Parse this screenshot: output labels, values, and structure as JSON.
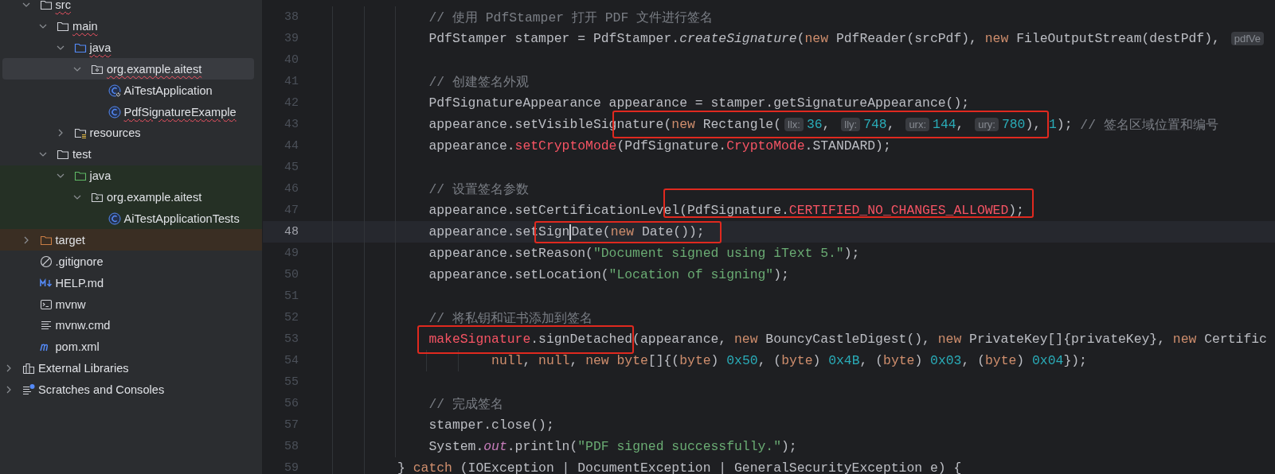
{
  "sidebar": {
    "project_files": [
      {
        "name": "src",
        "kind": "folder",
        "expanded": true,
        "error": true,
        "selected": false,
        "children": [
          {
            "name": "main",
            "kind": "folder",
            "expanded": true,
            "error": true,
            "selected": false,
            "children": [
              {
                "name": "java",
                "kind": "source-folder",
                "expanded": true,
                "error": true,
                "selected": false,
                "children": [
                  {
                    "name": "org.example.aitest",
                    "kind": "package",
                    "expanded": true,
                    "error": true,
                    "selected": true,
                    "children": [
                      {
                        "name": "AiTestApplication",
                        "kind": "main-class",
                        "error": false,
                        "selected": false
                      },
                      {
                        "name": "PdfSignatureExample",
                        "kind": "class",
                        "error": true,
                        "selected": false
                      }
                    ]
                  }
                ]
              },
              {
                "name": "resources",
                "kind": "resources-folder",
                "expanded": false,
                "error": false,
                "selected": false
              }
            ]
          },
          {
            "name": "test",
            "kind": "folder",
            "expanded": true,
            "error": false,
            "selected": false,
            "children": [
              {
                "name": "java",
                "kind": "test-folder",
                "expanded": true,
                "error": false,
                "selected": false,
                "color": "#253025",
                "children": [
                  {
                    "name": "org.example.aitest",
                    "kind": "package",
                    "expanded": true,
                    "error": false,
                    "selected": false,
                    "color": "#253025",
                    "children": [
                      {
                        "name": "AiTestApplicationTests",
                        "kind": "class",
                        "error": false,
                        "selected": false,
                        "color": "#253025"
                      }
                    ]
                  }
                ]
              }
            ]
          }
        ]
      },
      {
        "name": "target",
        "kind": "excluded-folder",
        "expanded": false,
        "error": false,
        "selected": false,
        "color": "#3a2e23"
      },
      {
        "name": ".gitignore",
        "kind": "gitignore",
        "error": false,
        "selected": false
      },
      {
        "name": "HELP.md",
        "kind": "markdown",
        "error": false,
        "selected": false
      },
      {
        "name": "mvnw",
        "kind": "script",
        "error": false,
        "selected": false
      },
      {
        "name": "mvnw.cmd",
        "kind": "text",
        "error": false,
        "selected": false
      },
      {
        "name": "pom.xml",
        "kind": "maven",
        "error": false,
        "selected": false
      }
    ],
    "roots": [
      {
        "name": "External Libraries",
        "kind": "libraries",
        "expanded": false,
        "error": false,
        "selected": false
      },
      {
        "name": "Scratches and Consoles",
        "kind": "scratches",
        "expanded": false,
        "error": false,
        "selected": false
      }
    ]
  },
  "editor": {
    "lines": [
      {
        "number": "38",
        "current": false,
        "kind": "statement",
        "tokens": [
          {
            "kind": "comment",
            "text": "// 使用 PdfStamper 打开 PDF 文件进行签名"
          }
        ]
      },
      {
        "number": "39",
        "current": false,
        "kind": "statement",
        "tokens": [
          {
            "kind": "plain",
            "text": "PdfStamper stamper = PdfStamper."
          },
          {
            "kind": "italic",
            "text": "createSignature"
          },
          {
            "kind": "plain",
            "text": "("
          },
          {
            "kind": "keyword",
            "text": "new"
          },
          {
            "kind": "plain",
            "text": " PdfReader(srcPdf), "
          },
          {
            "kind": "keyword",
            "text": "new"
          },
          {
            "kind": "plain",
            "text": " FileOutputStream(destPdf), "
          },
          {
            "kind": "hint",
            "text": "pdfVe"
          }
        ]
      },
      {
        "number": "40",
        "current": false,
        "kind": "statement"
      },
      {
        "number": "41",
        "current": false,
        "kind": "statement",
        "tokens": [
          {
            "kind": "comment",
            "text": "// 创建签名外观"
          }
        ]
      },
      {
        "number": "42",
        "current": false,
        "kind": "statement",
        "tokens": [
          {
            "kind": "plain",
            "text": "PdfSignatureAppearance appearance = stamper.getSignatureAppearance();"
          }
        ]
      },
      {
        "number": "43",
        "current": false,
        "kind": "statement",
        "tokens": [
          {
            "kind": "plain",
            "text": "appearance.setVisibleSignature("
          },
          {
            "kind": "keyword",
            "text": "new"
          },
          {
            "kind": "plain",
            "text": " Rectangle("
          },
          {
            "kind": "hint",
            "text": "llx:"
          },
          {
            "kind": "number",
            "text": "36"
          },
          {
            "kind": "plain",
            "text": ", "
          },
          {
            "kind": "hint",
            "text": "lly:"
          },
          {
            "kind": "number",
            "text": "748"
          },
          {
            "kind": "plain",
            "text": ", "
          },
          {
            "kind": "hint",
            "text": "urx:"
          },
          {
            "kind": "number",
            "text": "144"
          },
          {
            "kind": "plain",
            "text": ", "
          },
          {
            "kind": "hint",
            "text": "ury:"
          },
          {
            "kind": "number",
            "text": "780"
          },
          {
            "kind": "plain",
            "text": "), "
          },
          {
            "kind": "number",
            "text": "1"
          },
          {
            "kind": "plain",
            "text": "); "
          },
          {
            "kind": "comment",
            "text": "// 签名区域位置和编号"
          }
        ]
      },
      {
        "number": "44",
        "current": false,
        "kind": "statement",
        "tokens": [
          {
            "kind": "plain",
            "text": "appearance."
          },
          {
            "kind": "error",
            "text": "setCryptoMode"
          },
          {
            "kind": "plain",
            "text": "(PdfSignature."
          },
          {
            "kind": "error",
            "text": "CryptoMode"
          },
          {
            "kind": "plain",
            "text": ".STANDARD);"
          }
        ]
      },
      {
        "number": "45",
        "current": false,
        "kind": "statement"
      },
      {
        "number": "46",
        "current": false,
        "kind": "statement",
        "tokens": [
          {
            "kind": "comment",
            "text": "// 设置签名参数"
          }
        ]
      },
      {
        "number": "47",
        "current": false,
        "kind": "statement",
        "tokens": [
          {
            "kind": "plain",
            "text": "appearance.setCertificationLevel(PdfSignature."
          },
          {
            "kind": "error",
            "text": "CERTIFIED_NO_CHANGES_ALLOWED"
          },
          {
            "kind": "plain",
            "text": ");"
          }
        ]
      },
      {
        "number": "48",
        "current": true,
        "kind": "statement",
        "tokens": [
          {
            "kind": "plain",
            "text": "appearance.setSign"
          },
          {
            "kind": "caret"
          },
          {
            "kind": "plain",
            "text": "Date("
          },
          {
            "kind": "keyword",
            "text": "new"
          },
          {
            "kind": "plain",
            "text": " Date());"
          }
        ]
      },
      {
        "number": "49",
        "current": false,
        "kind": "statement",
        "tokens": [
          {
            "kind": "plain",
            "text": "appearance.setReason("
          },
          {
            "kind": "string",
            "text": "\"Document signed using iText 5.\""
          },
          {
            "kind": "plain",
            "text": ");"
          }
        ]
      },
      {
        "number": "50",
        "current": false,
        "kind": "statement",
        "tokens": [
          {
            "kind": "plain",
            "text": "appearance.setLocation("
          },
          {
            "kind": "string",
            "text": "\"Location of signing\""
          },
          {
            "kind": "plain",
            "text": ");"
          }
        ]
      },
      {
        "number": "51",
        "current": false,
        "kind": "statement"
      },
      {
        "number": "52",
        "current": false,
        "kind": "statement",
        "tokens": [
          {
            "kind": "comment",
            "text": "// 将私钥和证书添加到签名"
          }
        ]
      },
      {
        "number": "53",
        "current": false,
        "kind": "statement",
        "tokens": [
          {
            "kind": "error",
            "text": "makeSignature"
          },
          {
            "kind": "plain",
            "text": ".signDetached(appearance, "
          },
          {
            "kind": "keyword",
            "text": "new"
          },
          {
            "kind": "plain",
            "text": " BouncyCastleDigest(), "
          },
          {
            "kind": "keyword",
            "text": "new"
          },
          {
            "kind": "plain",
            "text": " PrivateKey[]{privateKey}, "
          },
          {
            "kind": "keyword",
            "text": "new"
          },
          {
            "kind": "plain",
            "text": " Certific"
          }
        ]
      },
      {
        "number": "54",
        "current": false,
        "kind": "continuation",
        "tokens": [
          {
            "kind": "keyword",
            "text": "null"
          },
          {
            "kind": "plain",
            "text": ", "
          },
          {
            "kind": "keyword",
            "text": "null"
          },
          {
            "kind": "plain",
            "text": ", "
          },
          {
            "kind": "keyword",
            "text": "new byte"
          },
          {
            "kind": "plain",
            "text": "[]{("
          },
          {
            "kind": "keyword",
            "text": "byte"
          },
          {
            "kind": "plain",
            "text": ") "
          },
          {
            "kind": "number",
            "text": "0x50"
          },
          {
            "kind": "plain",
            "text": ", ("
          },
          {
            "kind": "keyword",
            "text": "byte"
          },
          {
            "kind": "plain",
            "text": ") "
          },
          {
            "kind": "number",
            "text": "0x4B"
          },
          {
            "kind": "plain",
            "text": ", ("
          },
          {
            "kind": "keyword",
            "text": "byte"
          },
          {
            "kind": "plain",
            "text": ") "
          },
          {
            "kind": "number",
            "text": "0x03"
          },
          {
            "kind": "plain",
            "text": ", ("
          },
          {
            "kind": "keyword",
            "text": "byte"
          },
          {
            "kind": "plain",
            "text": ") "
          },
          {
            "kind": "number",
            "text": "0x04"
          },
          {
            "kind": "plain",
            "text": "});"
          }
        ]
      },
      {
        "number": "55",
        "current": false,
        "kind": "statement"
      },
      {
        "number": "56",
        "current": false,
        "kind": "statement",
        "tokens": [
          {
            "kind": "comment",
            "text": "// 完成签名"
          }
        ]
      },
      {
        "number": "57",
        "current": false,
        "kind": "statement",
        "tokens": [
          {
            "kind": "plain",
            "text": "stamper.close();"
          }
        ]
      },
      {
        "number": "58",
        "current": false,
        "kind": "statement",
        "tokens": [
          {
            "kind": "plain",
            "text": "System."
          },
          {
            "kind": "static",
            "text": "out"
          },
          {
            "kind": "plain",
            "text": ".println("
          },
          {
            "kind": "string",
            "text": "\"PDF signed successfully.\""
          },
          {
            "kind": "plain",
            "text": ");"
          }
        ]
      },
      {
        "number": "59",
        "current": false,
        "kind": "block-end",
        "tokens": [
          {
            "kind": "plain",
            "text": "} "
          },
          {
            "kind": "keyword",
            "text": "catch"
          },
          {
            "kind": "plain",
            "text": " (IOException | DocumentException | GeneralSecurityException e) {"
          }
        ]
      }
    ]
  }
}
